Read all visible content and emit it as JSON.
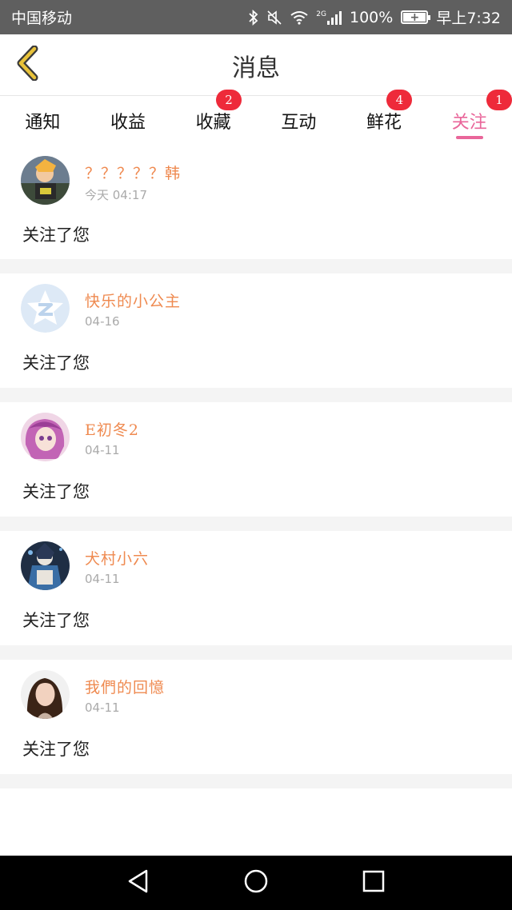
{
  "status_bar": {
    "carrier": "中国移动",
    "network": "2G",
    "battery": "100%",
    "time": "早上7:32"
  },
  "header": {
    "title": "消息",
    "back_icon": "chevron-left-icon"
  },
  "tabs": [
    {
      "label": "通知",
      "badge": null,
      "active": false
    },
    {
      "label": "收益",
      "badge": null,
      "active": false
    },
    {
      "label": "收藏",
      "badge": "2",
      "active": false
    },
    {
      "label": "互动",
      "badge": null,
      "active": false
    },
    {
      "label": "鲜花",
      "badge": "4",
      "active": false
    },
    {
      "label": "关注",
      "badge": "1",
      "active": true
    }
  ],
  "messages": [
    {
      "name": "？？？？？韩",
      "time": "今天 04:17",
      "text": "关注了您"
    },
    {
      "name": "快乐的小公主",
      "time": "04-16",
      "text": "关注了您"
    },
    {
      "name": "E初冬2",
      "time": "04-11",
      "text": "关注了您"
    },
    {
      "name": "犬村小六",
      "time": "04-11",
      "text": "关注了您"
    },
    {
      "name": "我們的回憶",
      "time": "04-11",
      "text": "关注了您"
    }
  ],
  "colors": {
    "accent": "#e9669a",
    "badge": "#ee2a3a",
    "username": "#ef8a50",
    "back_icon": "#e8c23a"
  },
  "nav": {
    "back": "triangle-back-icon",
    "home": "circle-home-icon",
    "recent": "square-recent-icon"
  }
}
